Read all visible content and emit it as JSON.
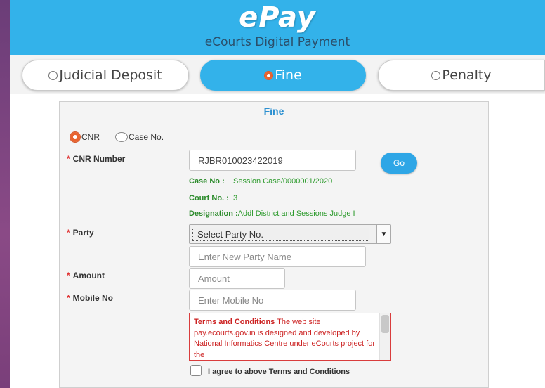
{
  "header": {
    "brand": "ePay",
    "subtitle": "eCourts Digital Payment"
  },
  "tabs": [
    {
      "label": "Judicial Deposit",
      "active": false
    },
    {
      "label": "Fine",
      "active": true
    },
    {
      "label": "Penalty",
      "active": false
    }
  ],
  "form": {
    "title": "Fine",
    "search_by": {
      "options": [
        "CNR",
        "Case No."
      ],
      "selected": "CNR"
    },
    "cnr_label": "CNR Number",
    "cnr_value": "RJBR010023422019",
    "go_label": "Go",
    "case_no_label": "Case No :",
    "case_no_value": "Session Case/0000001/2020",
    "court_no_label": "Court No. :",
    "court_no_value": "3",
    "designation_label": "Designation :",
    "designation_value": "Addl District and Sessions Judge I",
    "party_label": "Party",
    "party_select_value": "Select Party No.",
    "new_party_placeholder": "Enter New Party Name",
    "amount_label": "Amount",
    "amount_placeholder": "Amount",
    "mobile_label": "Mobile No",
    "mobile_placeholder": "Enter Mobile No",
    "required_marker": "*",
    "terms_title": "Terms and Conditions",
    "terms_text": " The web site pay.ecourts.gov.in is designed and developed by National Informatics Centre under eCourts project for the",
    "agree_label": "I agree to above Terms and Conditions",
    "agree_checked": false
  },
  "colors": {
    "banner": "#33b2ea",
    "accent_radio": "#e8632e",
    "info_text": "#2c9a2c",
    "terms_text": "#cc2222",
    "title": "#2a8fd0"
  }
}
